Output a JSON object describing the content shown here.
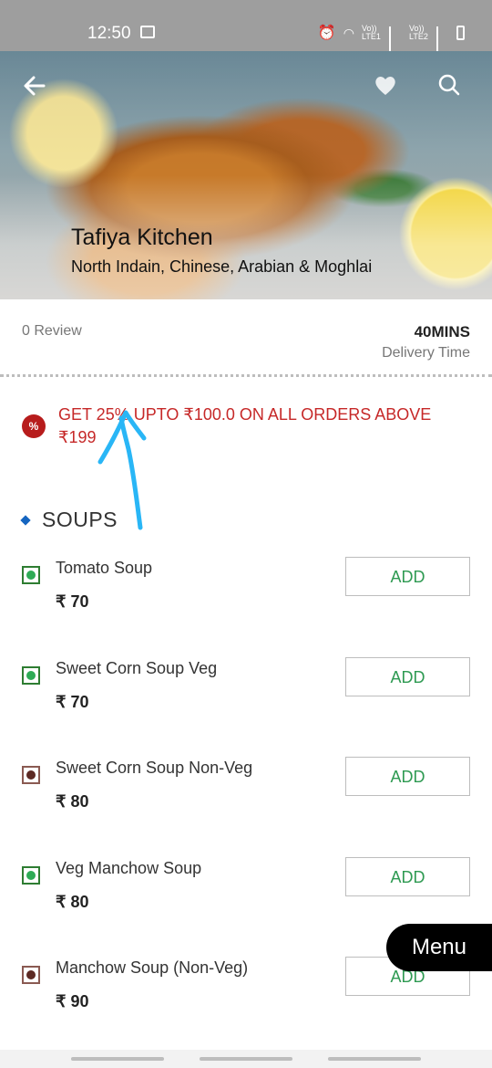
{
  "status_bar": {
    "time": "12:50",
    "network_1": "Vo)) LTE1",
    "network_2": "Vo)) LTE2"
  },
  "restaurant": {
    "name": "Tafiya Kitchen",
    "cuisine": "North Indain, Chinese, Arabian & Moghlai",
    "reviews": "0 Review",
    "delivery_time_value": "40MINS",
    "delivery_time_label": "Delivery Time"
  },
  "offer": {
    "icon": "%",
    "text": "GET 25% UPTO ₹100.0 ON ALL ORDERS ABOVE ₹199"
  },
  "section": {
    "title": "SOUPS"
  },
  "items": [
    {
      "name": "Tomato Soup",
      "price": "₹ 70",
      "type": "veg",
      "add_label": "ADD"
    },
    {
      "name": "Sweet Corn Soup Veg",
      "price": "₹ 70",
      "type": "veg",
      "add_label": "ADD"
    },
    {
      "name": "Sweet Corn Soup Non-Veg",
      "price": "₹ 80",
      "type": "non-veg",
      "add_label": "ADD"
    },
    {
      "name": "Veg Manchow Soup",
      "price": "₹ 80",
      "type": "veg",
      "add_label": "ADD"
    },
    {
      "name": "Manchow Soup (Non-Veg)",
      "price": "₹ 90",
      "type": "non-veg",
      "add_label": "ADD"
    }
  ],
  "menu_button": {
    "label": "Menu"
  },
  "colors": {
    "offer_red": "#c62828",
    "add_green": "#2e9a52",
    "annotation_blue": "#29b6f6"
  }
}
